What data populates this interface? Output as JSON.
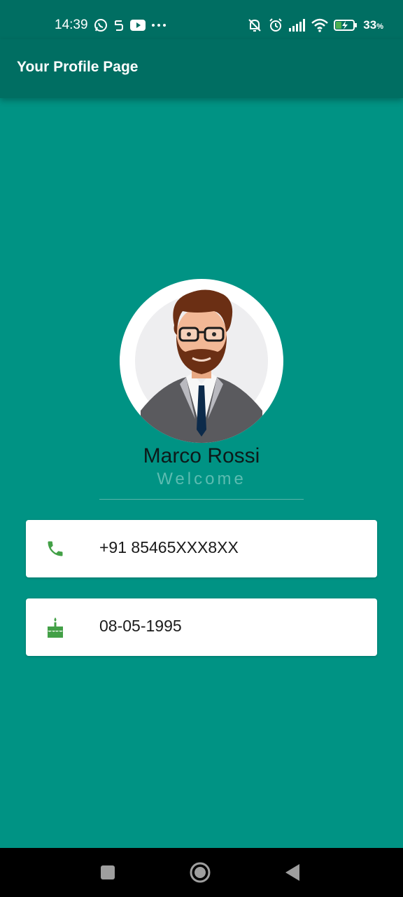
{
  "status_bar": {
    "time": "14:39",
    "left_icons": [
      "whatsapp-icon",
      "notification-app-icon",
      "youtube-icon",
      "more-dots-icon"
    ],
    "right_icons": [
      "bell-off-icon",
      "alarm-icon",
      "signal-icon",
      "wifi-icon",
      "battery-charging-icon"
    ],
    "battery_percent": "33",
    "battery_unit": "%"
  },
  "app_bar": {
    "title": "Your Profile Page"
  },
  "profile": {
    "name": "Marco Rossi",
    "subtitle": "Welcome",
    "avatar_icon": "person-avatar-icon"
  },
  "cards": {
    "phone": {
      "icon": "phone-icon",
      "value": "+91 85465XXX8XX"
    },
    "birthday": {
      "icon": "cake-icon",
      "value": "08-05-1995"
    }
  },
  "colors": {
    "background": "#009384",
    "app_bar": "#006e62",
    "card_icon": "#43a047",
    "subtitle": "#5cbcb1"
  },
  "nav_bar": {
    "buttons": [
      "recents-square-icon",
      "home-circle-icon",
      "back-triangle-icon"
    ]
  }
}
